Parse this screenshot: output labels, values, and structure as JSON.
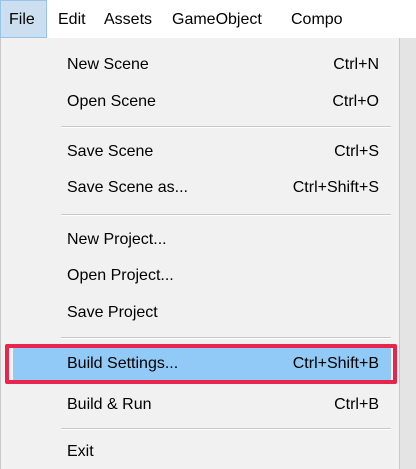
{
  "menubar": {
    "items": [
      {
        "label": "File"
      },
      {
        "label": "Edit"
      },
      {
        "label": "Assets"
      },
      {
        "label": "GameObject"
      },
      {
        "label": "Compo"
      }
    ]
  },
  "file_menu": {
    "new_scene": {
      "label": "New Scene",
      "shortcut": "Ctrl+N"
    },
    "open_scene": {
      "label": "Open Scene",
      "shortcut": "Ctrl+O"
    },
    "save_scene": {
      "label": "Save Scene",
      "shortcut": "Ctrl+S"
    },
    "save_scene_as": {
      "label": "Save Scene as...",
      "shortcut": "Ctrl+Shift+S"
    },
    "new_project": {
      "label": "New Project..."
    },
    "open_project": {
      "label": "Open Project..."
    },
    "save_project": {
      "label": "Save Project"
    },
    "build_settings": {
      "label": "Build Settings...",
      "shortcut": "Ctrl+Shift+B"
    },
    "build_and_run": {
      "label": "Build & Run",
      "shortcut": "Ctrl+B"
    },
    "exit": {
      "label": "Exit"
    }
  },
  "colors": {
    "highlight_fill": "#91c9f7",
    "highlight_frame": "#e8254d",
    "menu_background": "#f1f1f1"
  }
}
